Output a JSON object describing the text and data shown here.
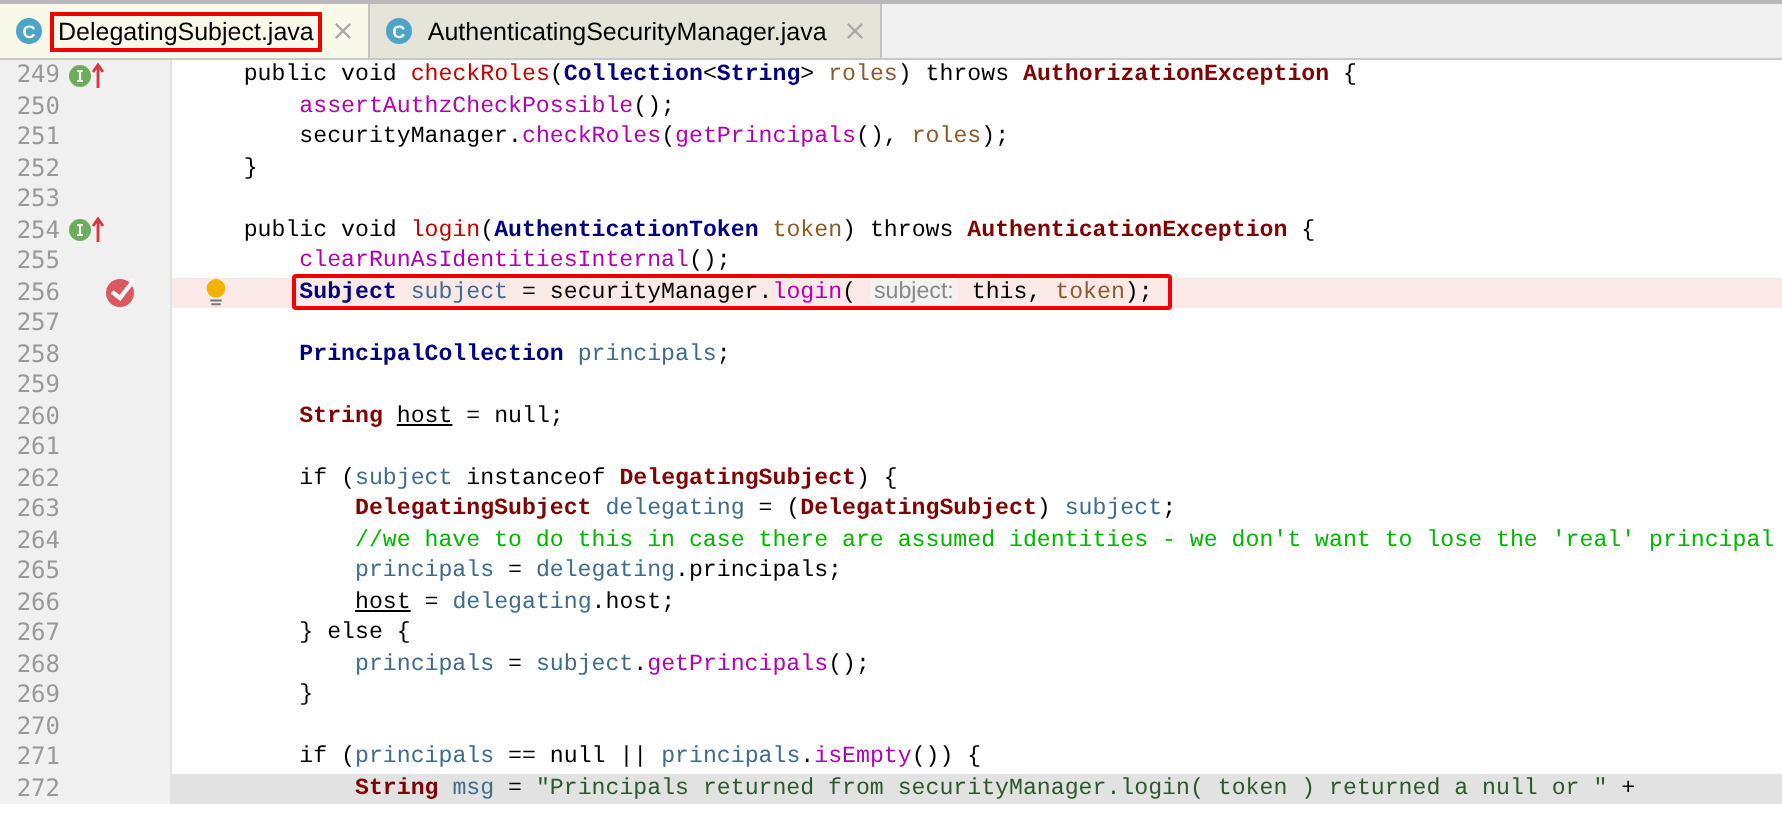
{
  "tabs": [
    {
      "icon_letter": "C",
      "label": "DelegatingSubject.java",
      "selected": true,
      "annotated": true
    },
    {
      "icon_letter": "C",
      "label": "AuthenticatingSecurityManager.java",
      "selected": false,
      "annotated": false
    }
  ],
  "lines": [
    {
      "number": "249",
      "implements_marker": true,
      "tokens": [
        {
          "kind": "plain",
          "text": "public void "
        },
        {
          "kind": "decl",
          "text": "checkRoles"
        },
        {
          "kind": "plain",
          "text": "("
        },
        {
          "kind": "type",
          "text": "Collection"
        },
        {
          "kind": "plain",
          "text": "<"
        },
        {
          "kind": "type",
          "text": "String"
        },
        {
          "kind": "plain",
          "text": ">"
        },
        {
          "kind": "param",
          "text": " roles"
        },
        {
          "kind": "plain",
          "text": ") throws "
        },
        {
          "kind": "class",
          "text": "AuthorizationException"
        },
        {
          "kind": "plain",
          "text": " {"
        }
      ],
      "children": [
        {
          "number": "250",
          "tokens": [
            {
              "kind": "call",
              "text": "assertAuthzCheckPossible"
            },
            {
              "kind": "plain",
              "text": "();"
            }
          ]
        },
        {
          "number": "251",
          "tokens": [
            {
              "kind": "plain",
              "text": "securityManager."
            },
            {
              "kind": "call",
              "text": "checkRoles"
            },
            {
              "kind": "plain",
              "text": "("
            },
            {
              "kind": "call",
              "text": "getPrincipals"
            },
            {
              "kind": "plain",
              "text": "(),"
            },
            {
              "kind": "param",
              "text": " roles"
            },
            {
              "kind": "plain",
              "text": ");"
            }
          ]
        }
      ]
    },
    {
      "number": "252",
      "tokens": [
        {
          "kind": "plain",
          "text": "}"
        }
      ]
    },
    {
      "number": "253"
    },
    {
      "number": "254",
      "implements_marker": true,
      "tokens": [
        {
          "kind": "plain",
          "text": "public void "
        },
        {
          "kind": "decl",
          "text": "login"
        },
        {
          "kind": "plain",
          "text": "("
        },
        {
          "kind": "type",
          "text": "AuthenticationToken"
        },
        {
          "kind": "param",
          "text": " token"
        },
        {
          "kind": "plain",
          "text": ") throws "
        },
        {
          "kind": "class",
          "text": "AuthenticationException"
        },
        {
          "kind": "plain",
          "text": " {"
        }
      ],
      "children": [
        {
          "number": "255",
          "tokens": [
            {
              "kind": "call",
              "text": "clearRunAsIdentitiesInternal"
            },
            {
              "kind": "plain",
              "text": "();"
            }
          ]
        },
        {
          "number": "256",
          "breakpoint": true,
          "intention": true,
          "annotated": true,
          "tokens": [
            {
              "kind": "type",
              "text": "Subject"
            },
            {
              "kind": "var",
              "text": " subject"
            },
            {
              "kind": "plain",
              "text": " = securityManager."
            },
            {
              "kind": "call",
              "text": "login"
            },
            {
              "kind": "plain",
              "text": "( "
            },
            {
              "kind": "hint",
              "text": "subject:"
            },
            {
              "kind": "plain",
              "text": " this, "
            },
            {
              "kind": "param",
              "text": "token"
            },
            {
              "kind": "plain",
              "text": ");"
            }
          ]
        },
        {
          "number": "257"
        },
        {
          "number": "258",
          "tokens": [
            {
              "kind": "type",
              "text": "PrincipalCollection"
            },
            {
              "kind": "var",
              "text": " principals"
            },
            {
              "kind": "plain",
              "text": ";"
            }
          ]
        },
        {
          "number": "259"
        },
        {
          "number": "260",
          "tokens": [
            {
              "kind": "class",
              "text": "String "
            },
            {
              "kind": "under",
              "text": "host"
            },
            {
              "kind": "plain",
              "text": " = null;"
            }
          ]
        },
        {
          "number": "261"
        },
        {
          "number": "262",
          "tokens": [
            {
              "kind": "plain",
              "text": "if ("
            },
            {
              "kind": "var",
              "text": "subject"
            },
            {
              "kind": "plain",
              "text": " instanceof "
            },
            {
              "kind": "class",
              "text": "DelegatingSubject"
            },
            {
              "kind": "plain",
              "text": ") {"
            }
          ],
          "children": [
            {
              "number": "263",
              "tokens": [
                {
                  "kind": "class",
                  "text": "DelegatingSubject"
                },
                {
                  "kind": "var",
                  "text": " delegating"
                },
                {
                  "kind": "plain",
                  "text": " = ("
                },
                {
                  "kind": "class",
                  "text": "DelegatingSubject"
                },
                {
                  "kind": "plain",
                  "text": ")"
                },
                {
                  "kind": "var",
                  "text": " subject"
                },
                {
                  "kind": "plain",
                  "text": ";"
                }
              ]
            },
            {
              "number": "264",
              "tokens": [
                {
                  "kind": "comment",
                  "text": "//we have to do this in case there are assumed identities - we don't want to lose the 'real' principal"
                }
              ]
            },
            {
              "number": "265",
              "tokens": [
                {
                  "kind": "var",
                  "text": "principals"
                },
                {
                  "kind": "plain",
                  "text": " = "
                },
                {
                  "kind": "var",
                  "text": "delegating"
                },
                {
                  "kind": "plain",
                  "text": ".principals;"
                }
              ]
            },
            {
              "number": "266",
              "tokens": [
                {
                  "kind": "under",
                  "text": "host"
                },
                {
                  "kind": "plain",
                  "text": " = "
                },
                {
                  "kind": "var",
                  "text": "delegating"
                },
                {
                  "kind": "plain",
                  "text": ".host;"
                }
              ]
            }
          ]
        },
        {
          "number": "267",
          "tokens": [
            {
              "kind": "plain",
              "text": "} else {"
            }
          ],
          "children": [
            {
              "number": "268",
              "tokens": [
                {
                  "kind": "var",
                  "text": "principals"
                },
                {
                  "kind": "plain",
                  "text": " = "
                },
                {
                  "kind": "var",
                  "text": "subject"
                },
                {
                  "kind": "plain",
                  "text": "."
                },
                {
                  "kind": "call",
                  "text": "getPrincipals"
                },
                {
                  "kind": "plain",
                  "text": "();"
                }
              ]
            }
          ]
        },
        {
          "number": "269",
          "tokens": [
            {
              "kind": "plain",
              "text": "}"
            }
          ]
        },
        {
          "number": "270"
        },
        {
          "number": "271",
          "tokens": [
            {
              "kind": "plain",
              "text": "if ("
            },
            {
              "kind": "var",
              "text": "principals"
            },
            {
              "kind": "plain",
              "text": " == null || "
            },
            {
              "kind": "var",
              "text": "principals"
            },
            {
              "kind": "plain",
              "text": "."
            },
            {
              "kind": "call",
              "text": "isEmpty"
            },
            {
              "kind": "plain",
              "text": "()) {"
            }
          ],
          "children": [
            {
              "number": "272",
              "caret_line": true,
              "tokens": [
                {
                  "kind": "class",
                  "text": "String"
                },
                {
                  "kind": "var",
                  "text": " msg"
                },
                {
                  "kind": "plain",
                  "text": " = "
                },
                {
                  "kind": "string",
                  "text": "\"Principals returned from securityManager.login( token ) returned a null or \""
                },
                {
                  "kind": "plain",
                  "text": " +"
                }
              ]
            }
          ]
        }
      ]
    }
  ]
}
